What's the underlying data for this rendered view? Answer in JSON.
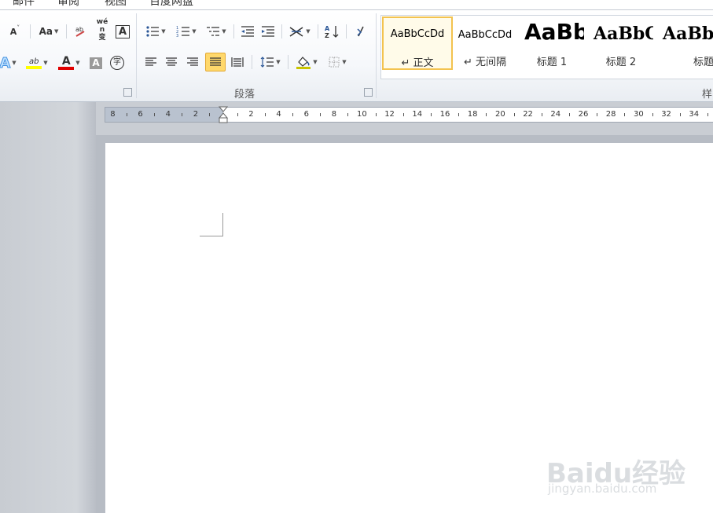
{
  "tabs": [
    "邮件",
    "审阅",
    "视图",
    "百度网盘"
  ],
  "font_group": {
    "shrink_label": "A",
    "change_case_label": "Aa",
    "phonetic_label": "wén 变",
    "char_border_label": "A",
    "text_effect_label": "A",
    "highlight_label": "ab",
    "font_color_label": "A",
    "char_shading_label": "A",
    "enclose_label": "字",
    "highlight_color": "#ffff00",
    "font_color": "#e00000"
  },
  "paragraph_group": {
    "label": "段落"
  },
  "styles_group": {
    "label": "样",
    "items": [
      {
        "sample": "AaBbCcDd",
        "name": "↵ 正文"
      },
      {
        "sample": "AaBbCcDd",
        "name": "↵ 无间隔"
      },
      {
        "sample": "AaBb",
        "name": "标题 1"
      },
      {
        "sample": "AaBbC",
        "name": "标题 2"
      },
      {
        "sample": "AaBb",
        "name": "标题"
      }
    ]
  },
  "ruler": {
    "left_labels": [
      "8",
      "6",
      "4",
      "2"
    ],
    "right_labels": [
      "2",
      "4",
      "6",
      "8",
      "10",
      "12",
      "14",
      "16",
      "18",
      "20",
      "22",
      "24",
      "26",
      "28",
      "30",
      "32",
      "34"
    ]
  },
  "watermark": {
    "logo": "Baidu经验",
    "url": "jingyan.baidu.com"
  },
  "colors": {
    "selected_style_border": "#f3c34f",
    "justify_active_bg": "#ffd86b"
  }
}
